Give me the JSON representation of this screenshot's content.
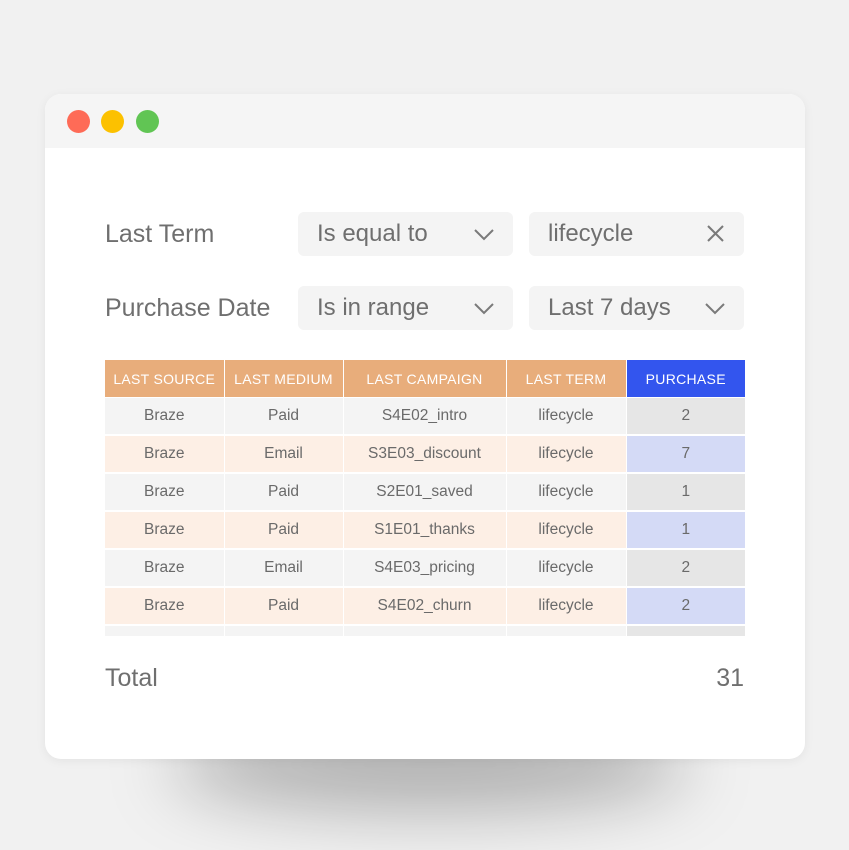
{
  "window": {
    "controls": [
      "close",
      "minimize",
      "maximize"
    ],
    "colors": {
      "close": "#fe6b57",
      "minimize": "#fcc100",
      "maximize": "#61c554"
    }
  },
  "filters": [
    {
      "label": "Last Term",
      "operator": "Is equal to",
      "operator_icon": "chevron-down-icon",
      "value": "lifecycle",
      "value_icon": "close-icon"
    },
    {
      "label": "Purchase Date",
      "operator": "Is in range",
      "operator_icon": "chevron-down-icon",
      "value": "Last 7 days",
      "value_icon": "chevron-down-icon"
    }
  ],
  "table": {
    "columns": [
      "LAST SOURCE",
      "LAST MEDIUM",
      "LAST CAMPAIGN",
      "LAST TERM",
      "PURCHASE"
    ],
    "header_color": "#e8ad7b",
    "highlight_color": "#3355ee",
    "rows": [
      [
        "Braze",
        "Paid",
        "S4E02_intro",
        "lifecycle",
        "2"
      ],
      [
        "Braze",
        "Email",
        "S3E03_discount",
        "lifecycle",
        "7"
      ],
      [
        "Braze",
        "Paid",
        "S2E01_saved",
        "lifecycle",
        "1"
      ],
      [
        "Braze",
        "Paid",
        "S1E01_thanks",
        "lifecycle",
        "1"
      ],
      [
        "Braze",
        "Email",
        "S4E03_pricing",
        "lifecycle",
        "2"
      ],
      [
        "Braze",
        "Paid",
        "S4E02_churn",
        "lifecycle",
        "2"
      ]
    ]
  },
  "total": {
    "label": "Total",
    "value": "31"
  }
}
